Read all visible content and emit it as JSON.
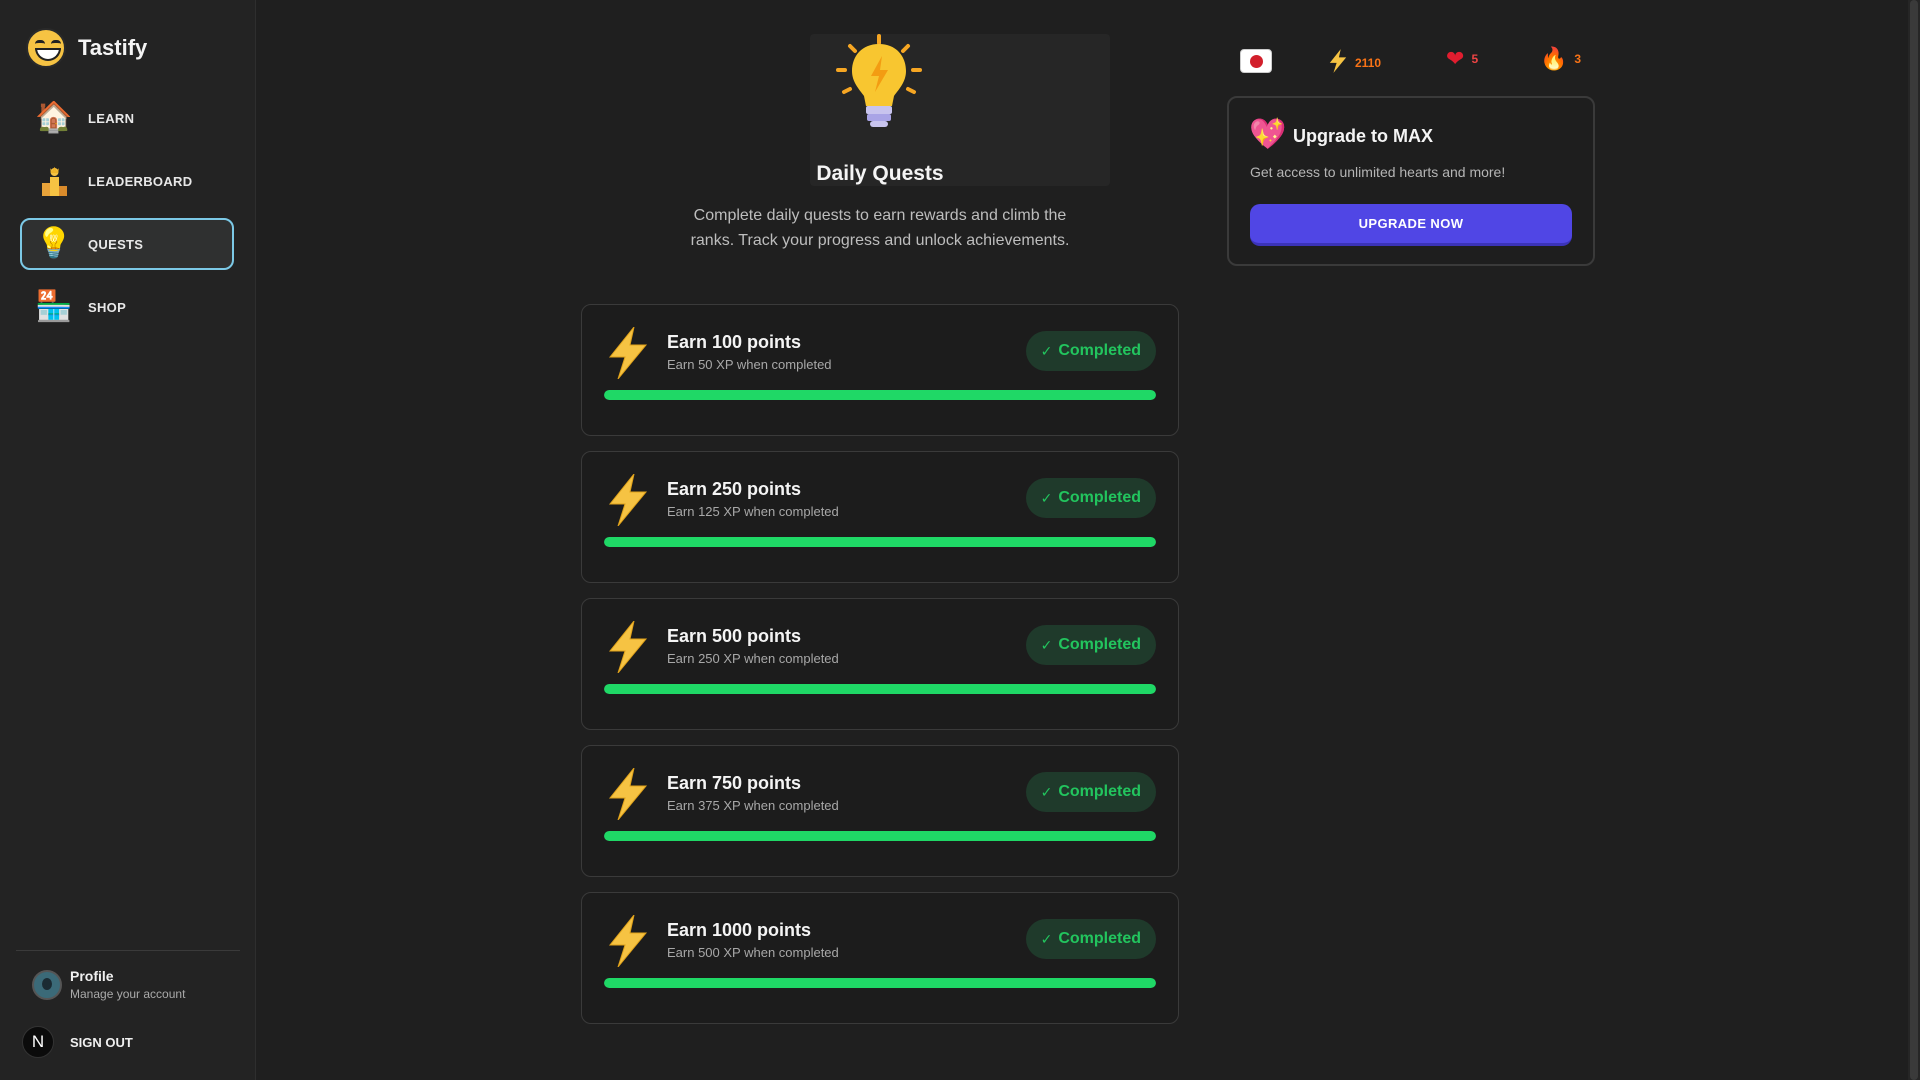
{
  "app": {
    "name": "Tastify"
  },
  "sidebar": {
    "items": [
      {
        "label": "LEARN",
        "icon": "house-icon"
      },
      {
        "label": "LEADERBOARD",
        "icon": "podium-icon"
      },
      {
        "label": "QUESTS",
        "icon": "lightbulb-icon",
        "active": true
      },
      {
        "label": "SHOP",
        "icon": "store-icon"
      }
    ],
    "profile": {
      "title": "Profile",
      "subtitle": "Manage your account"
    },
    "signout": {
      "label": "SIGN OUT",
      "logo": "N"
    }
  },
  "header": {
    "title": "Daily Quests",
    "description": "Complete daily quests to earn rewards and climb the ranks. Track your progress and unlock achievements."
  },
  "quests": [
    {
      "title": "Earn 100 points",
      "subtitle": "Earn 50 XP when completed",
      "status": "Completed",
      "progress": 1.0
    },
    {
      "title": "Earn 250 points",
      "subtitle": "Earn 125 XP when completed",
      "status": "Completed",
      "progress": 1.0
    },
    {
      "title": "Earn 500 points",
      "subtitle": "Earn 250 XP when completed",
      "status": "Completed",
      "progress": 1.0
    },
    {
      "title": "Earn 750 points",
      "subtitle": "Earn 375 XP when completed",
      "status": "Completed",
      "progress": 1.0
    },
    {
      "title": "Earn 1000 points",
      "subtitle": "Earn 500 XP when completed",
      "status": "Completed",
      "progress": 1.0
    }
  ],
  "stats": {
    "points": "2110",
    "hearts": "5",
    "streak": "3",
    "colors": {
      "points": "#f97316",
      "hearts": "#ef4444",
      "streak": "#f97316"
    }
  },
  "upgrade": {
    "title": "Upgrade to MAX",
    "description": "Get access to unlimited hearts and more!",
    "button": "UPGRADE NOW"
  },
  "colors": {
    "accent": "#5046e5",
    "success": "#22c55e",
    "progress": "#1fd866",
    "active_border": "#7cc9e6"
  }
}
